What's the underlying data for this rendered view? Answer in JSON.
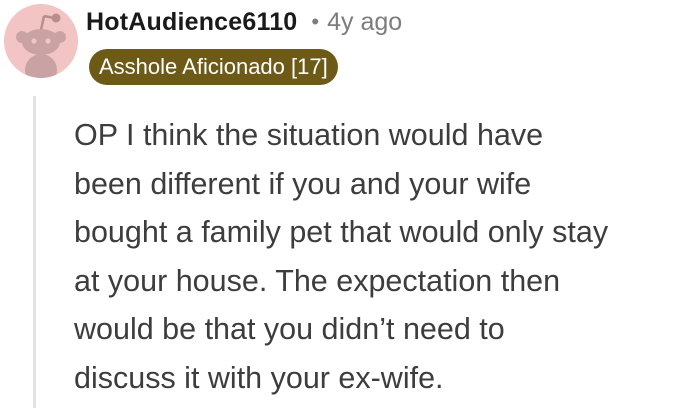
{
  "comment": {
    "author": "HotAudience6110",
    "separator": "•",
    "age": "4y ago",
    "flair": "Asshole Aficionado [17]",
    "text_lines": [
      "OP I think the situation would have",
      "been different if you and your wife",
      "bought a family pet that would only stay",
      "at your house. The expectation then",
      "would be that you didn’t need to",
      "discuss it with your ex-wife."
    ]
  },
  "icons": {
    "avatar": "snoo-avatar-icon"
  },
  "colors": {
    "avatar_background": "#f3c4c4",
    "flair_background": "#6e5a17",
    "flair_text": "#ffffff",
    "meta_text": "#7c7c7c",
    "body_text": "#3d3d3d",
    "thread_line": "#e3e3e3"
  }
}
